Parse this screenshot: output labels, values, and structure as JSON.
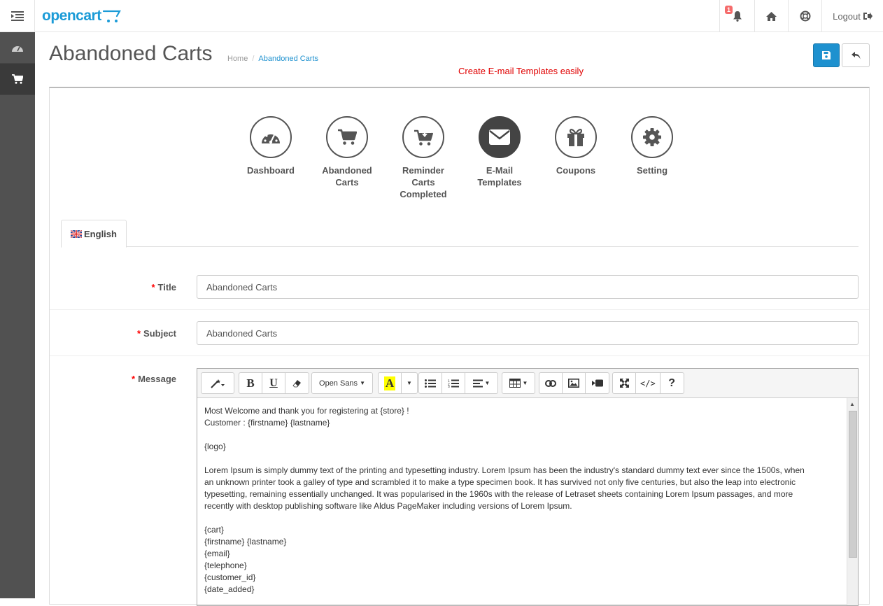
{
  "header": {
    "logo_text": "opencart",
    "notification_count": "1",
    "logout_label": "Logout"
  },
  "page": {
    "title": "Abandoned Carts",
    "breadcrumb": [
      "Home",
      "Abandoned Carts"
    ]
  },
  "annotation": "Create E-mail Templates easily",
  "nav": [
    {
      "label": "Dashboard",
      "icon": "dashboard-icon"
    },
    {
      "label": "Abandoned Carts",
      "icon": "cart-icon"
    },
    {
      "label": "Reminder Carts Completed",
      "icon": "cart-download-icon"
    },
    {
      "label": "E-Mail Templates",
      "icon": "envelope-icon"
    },
    {
      "label": "Coupons",
      "icon": "gift-icon"
    },
    {
      "label": "Setting",
      "icon": "gear-icon"
    }
  ],
  "tabs": [
    {
      "label": "English"
    }
  ],
  "form": {
    "title_label": "Title",
    "title_value": "Abandoned Carts",
    "subject_label": "Subject",
    "subject_value": "Abandoned Carts",
    "message_label": "Message"
  },
  "editor": {
    "font_name": "Open Sans",
    "lines": [
      "Most Welcome and thank you for registering at {store} !",
      "Customer : {firstname}  {lastname}",
      "",
      "{logo}",
      "",
      "Lorem Ipsum is simply dummy text of the printing and typesetting industry. Lorem Ipsum has been the industry's standard dummy text ever since the 1500s, when",
      "an unknown printer took a galley of type and scrambled it to make a type specimen book. It has survived not only five centuries, but also the leap into electronic",
      "typesetting, remaining essentially unchanged. It was popularised in the 1960s with the release of Letraset sheets containing Lorem Ipsum passages, and more",
      "recently with desktop publishing software like Aldus PageMaker including versions of Lorem Ipsum.",
      "",
      "{cart}",
      "{firstname} {lastname}",
      "{email}",
      "{telephone}",
      "{customer_id}",
      "{date_added}"
    ]
  },
  "colors": {
    "accent": "#1e91cf",
    "sidebar": "#515151",
    "annotation": "#e00000",
    "required": "#ff0000"
  }
}
